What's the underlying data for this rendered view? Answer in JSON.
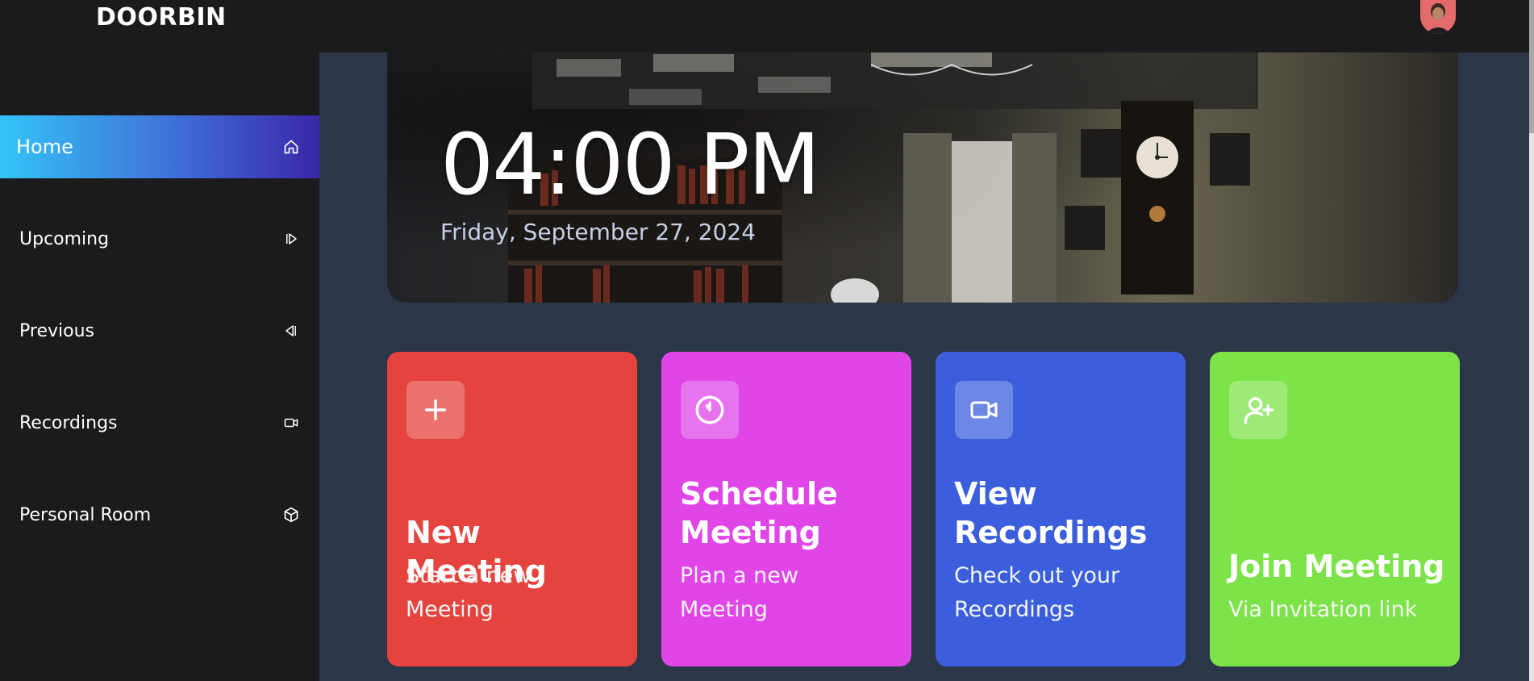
{
  "app": {
    "logo": "DOORBIN"
  },
  "sidebar": {
    "items": [
      {
        "label": "Home",
        "icon": "home-icon",
        "active": true
      },
      {
        "label": "Upcoming",
        "icon": "skip-forward-icon"
      },
      {
        "label": "Previous",
        "icon": "skip-back-icon"
      },
      {
        "label": "Recordings",
        "icon": "video-icon"
      },
      {
        "label": "Personal Room",
        "icon": "cube-icon"
      }
    ]
  },
  "hero": {
    "time": "04:00 PM",
    "date": "Friday, September 27, 2024"
  },
  "cards": [
    {
      "title": "New Meeting",
      "subtitle": "Start a new Meeting",
      "icon": "plus-icon",
      "color": "#e5433d"
    },
    {
      "title": "Schedule Meeting",
      "subtitle": "Plan a new Meeting",
      "icon": "clock-icon",
      "color": "#e045e8"
    },
    {
      "title": "View Recordings",
      "subtitle": "Check out your Recordings",
      "icon": "video-icon",
      "color": "#3b5fdc"
    },
    {
      "title": "Join Meeting",
      "subtitle": "Via Invitation link",
      "icon": "user-plus-icon",
      "color": "#7ce448"
    }
  ],
  "colors": {
    "topbar": "#1b1b1e",
    "sidebar": "#1b1b1e",
    "main_bg": "#2c3649"
  }
}
